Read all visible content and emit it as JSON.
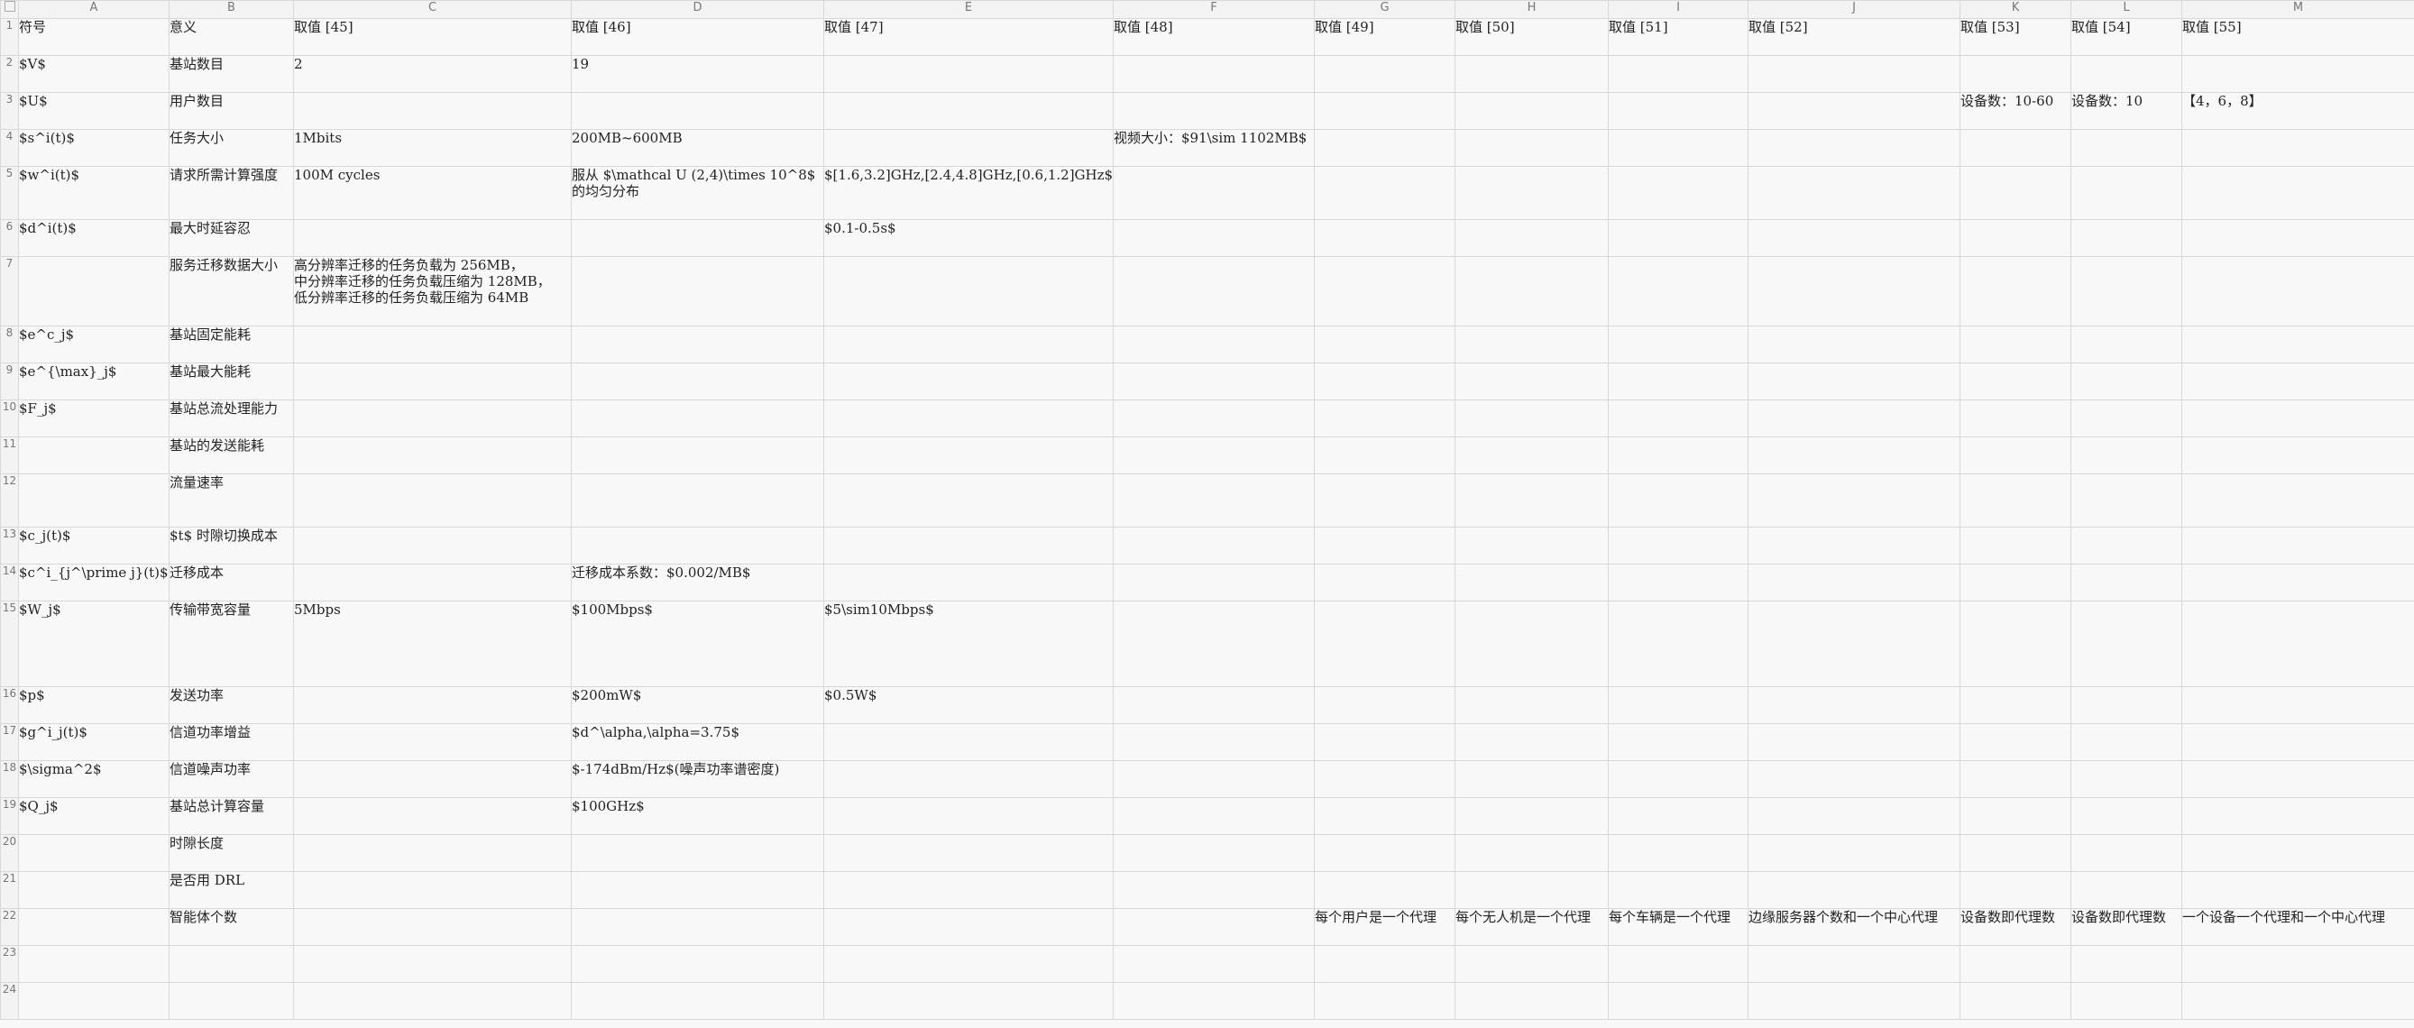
{
  "columns": [
    "A",
    "B",
    "C",
    "D",
    "E",
    "F",
    "G",
    "H",
    "I",
    "J",
    "K",
    "L",
    "M"
  ],
  "rows": [
    {
      "n": "1",
      "cells": [
        "符号",
        "意义",
        "取值 [45]",
        "取值 [46]",
        "取值 [47]",
        "取值 [48]",
        "取值 [49]",
        "取值 [50]",
        "取值 [51]",
        "取值 [52]",
        "取值 [53]",
        "取值 [54]",
        "取值 [55]"
      ]
    },
    {
      "n": "2",
      "cells": [
        "$V$",
        "基站数目",
        "2",
        "19",
        "",
        "",
        "",
        "",
        "",
        "",
        "",
        "",
        ""
      ]
    },
    {
      "n": "3",
      "cells": [
        "$U$",
        "用户数目",
        "",
        "",
        "",
        "",
        "",
        "",
        "",
        "",
        "设备数：10-60",
        "设备数：10",
        "【4，6，8】"
      ]
    },
    {
      "n": "4",
      "cells": [
        "$s^i(t)$",
        "任务大小",
        "1Mbits",
        "200MB~600MB",
        "",
        "视频大小：$91\\sim 1102MB$",
        "",
        "",
        "",
        "",
        "",
        "",
        ""
      ]
    },
    {
      "n": "5",
      "cells": [
        "$w^i(t)$",
        "请求所需计算强度",
        "100M cycles",
        "服从 $\\mathcal U (2,4)\\times 10^8$ 的均匀分布",
        "$[1.6,3.2]GHz,[2.4,4.8]GHz,[0.6,1.2]GHz$",
        "",
        "",
        "",
        "",
        "",
        "",
        "",
        ""
      ]
    },
    {
      "n": "6",
      "cells": [
        "$d^i(t)$",
        "最大时延容忍",
        "",
        "",
        "$0.1-0.5s$",
        "",
        "",
        "",
        "",
        "",
        "",
        "",
        ""
      ]
    },
    {
      "n": "7",
      "cells": [
        "",
        "服务迁移数据大小",
        "高分辨率迁移的任务负载为 256MB，\n中分辨率迁移的任务负载压缩为 128MB，\n低分辨率迁移的任务负载压缩为 64MB",
        "",
        "",
        "",
        "",
        "",
        "",
        "",
        "",
        "",
        ""
      ]
    },
    {
      "n": "8",
      "cells": [
        "$e^c_j$",
        "基站固定能耗",
        "",
        "",
        "",
        "",
        "",
        "",
        "",
        "",
        "",
        "",
        ""
      ]
    },
    {
      "n": "9",
      "cells": [
        "$e^{\\max}_j$",
        "基站最大能耗",
        "",
        "",
        "",
        "",
        "",
        "",
        "",
        "",
        "",
        "",
        ""
      ]
    },
    {
      "n": "10",
      "cells": [
        "$F_j$",
        "基站总流处理能力",
        "",
        "",
        "",
        "",
        "",
        "",
        "",
        "",
        "",
        "",
        ""
      ]
    },
    {
      "n": "11",
      "cells": [
        "",
        "基站的发送能耗",
        "",
        "",
        "",
        "",
        "",
        "",
        "",
        "",
        "",
        "",
        ""
      ]
    },
    {
      "n": "12",
      "cells": [
        "",
        "流量速率",
        "",
        "",
        "",
        "",
        "",
        "",
        "",
        "",
        "",
        "",
        ""
      ]
    },
    {
      "n": "13",
      "cells": [
        "$c_j(t)$",
        "$t$ 时隙切换成本",
        "",
        "",
        "",
        "",
        "",
        "",
        "",
        "",
        "",
        "",
        ""
      ]
    },
    {
      "n": "14",
      "cells": [
        "$c^i_{j^\\prime j}(t)$",
        "迁移成本",
        "",
        "迁移成本系数：$0.002/MB$",
        "",
        "",
        "",
        "",
        "",
        "",
        "",
        "",
        ""
      ]
    },
    {
      "n": "15",
      "cells": [
        "$W_j$",
        "传输带宽容量",
        "5Mbps",
        "$100Mbps$",
        "$5\\sim10Mbps$",
        "",
        "",
        "",
        "",
        "",
        "",
        "",
        ""
      ]
    },
    {
      "n": "16",
      "cells": [
        "$p$",
        "发送功率",
        "",
        "$200mW$",
        "$0.5W$",
        "",
        "",
        "",
        "",
        "",
        "",
        "",
        ""
      ]
    },
    {
      "n": "17",
      "cells": [
        "$g^i_j(t)$",
        "信道功率增益",
        "",
        "$d^\\alpha,\\alpha=3.75$",
        "",
        "",
        "",
        "",
        "",
        "",
        "",
        "",
        ""
      ]
    },
    {
      "n": "18",
      "cells": [
        "$\\sigma^2$",
        "信道噪声功率",
        "",
        "$-174dBm/Hz$(噪声功率谱密度)",
        "",
        "",
        "",
        "",
        "",
        "",
        "",
        "",
        ""
      ]
    },
    {
      "n": "19",
      "cells": [
        "$Q_j$",
        "基站总计算容量",
        "",
        "$100GHz$",
        "",
        "",
        "",
        "",
        "",
        "",
        "",
        "",
        ""
      ]
    },
    {
      "n": "20",
      "cells": [
        "",
        "时隙长度",
        "",
        "",
        "",
        "",
        "",
        "",
        "",
        "",
        "",
        "",
        ""
      ]
    },
    {
      "n": "21",
      "cells": [
        "",
        "是否用 DRL",
        "",
        "",
        "",
        "",
        "",
        "",
        "",
        "",
        "",
        "",
        ""
      ]
    },
    {
      "n": "22",
      "cells": [
        "",
        "智能体个数",
        "",
        "",
        "",
        "",
        "每个用户是一个代理",
        "每个无人机是一个代理",
        "每个车辆是一个代理",
        "边缘服务器个数和一个中心代理",
        "设备数即代理数",
        "设备数即代理数",
        "一个设备一个代理和一个中心代理"
      ]
    },
    {
      "n": "23",
      "cells": [
        "",
        "",
        "",
        "",
        "",
        "",
        "",
        "",
        "",
        "",
        "",
        "",
        ""
      ]
    },
    {
      "n": "24",
      "cells": [
        "",
        "",
        "",
        "",
        "",
        "",
        "",
        "",
        "",
        "",
        "",
        "",
        ""
      ]
    }
  ]
}
